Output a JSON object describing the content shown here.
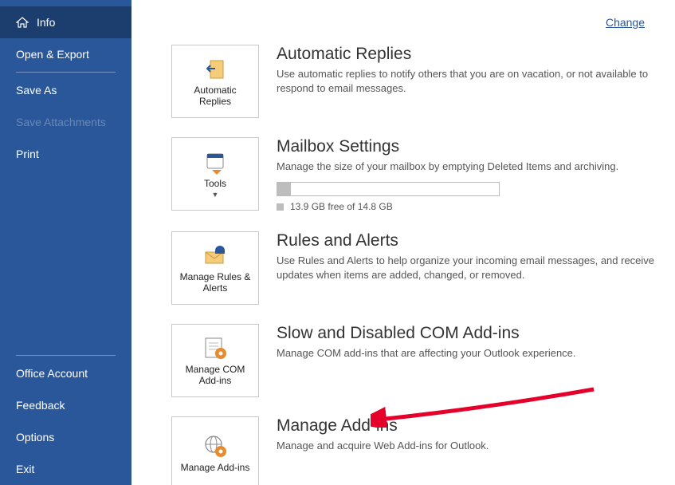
{
  "sidebar": {
    "items": [
      {
        "label": "Info",
        "icon": "home-icon",
        "selected": true
      },
      {
        "label": "Open & Export"
      },
      {
        "label": "Save As"
      },
      {
        "label": "Save Attachments",
        "disabled": true
      },
      {
        "label": "Print"
      },
      {
        "label": "Office Account"
      },
      {
        "label": "Feedback"
      },
      {
        "label": "Options"
      },
      {
        "label": "Exit"
      }
    ]
  },
  "change_link": "Change",
  "sections": {
    "auto_replies": {
      "tile": "Automatic Replies",
      "heading": "Automatic Replies",
      "desc": "Use automatic replies to notify others that you are on vacation, or not available to respond to email messages."
    },
    "mailbox": {
      "tile": "Tools",
      "heading": "Mailbox Settings",
      "desc": "Manage the size of your mailbox by emptying Deleted Items and archiving.",
      "quota_text": "13.9 GB free of 14.8 GB",
      "quota_pct": 6
    },
    "rules": {
      "tile": "Manage Rules & Alerts",
      "heading": "Rules and Alerts",
      "desc": "Use Rules and Alerts to help organize your incoming email messages, and receive updates when items are added, changed, or removed."
    },
    "com_addins": {
      "tile": "Manage COM Add-ins",
      "heading": "Slow and Disabled COM Add-ins",
      "desc": "Manage COM add-ins that are affecting your Outlook experience."
    },
    "web_addins": {
      "tile": "Manage Add-ins",
      "heading": "Manage Add-ins",
      "desc": "Manage and acquire Web Add-ins for Outlook."
    }
  }
}
